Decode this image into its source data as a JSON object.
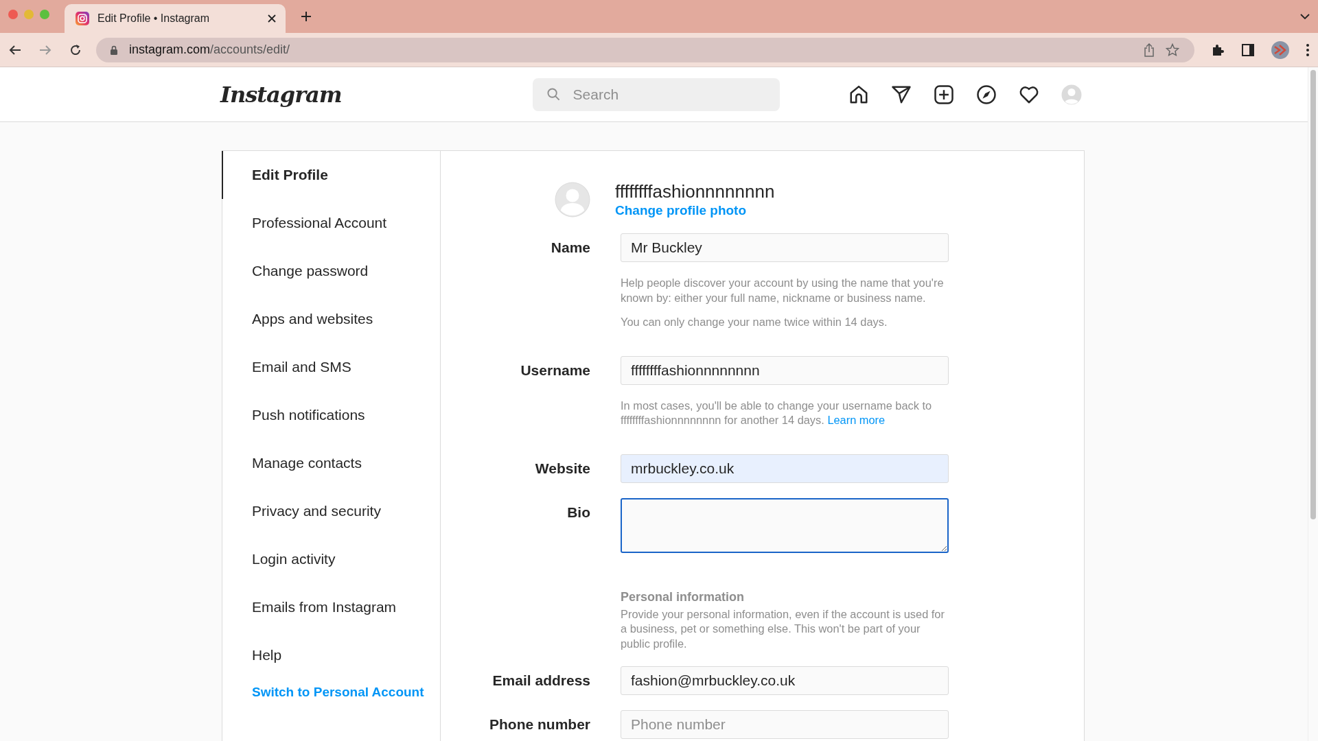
{
  "browser": {
    "tab": {
      "title": "Edit Profile • Instagram"
    },
    "url_host": "instagram.com",
    "url_path": "/accounts/edit/"
  },
  "header": {
    "logo": "Instagram",
    "search": {
      "placeholder": "Search"
    }
  },
  "sidebar": {
    "items": [
      {
        "label": "Edit Profile",
        "selected": true
      },
      {
        "label": "Professional Account",
        "selected": false
      },
      {
        "label": "Change password",
        "selected": false
      },
      {
        "label": "Apps and websites",
        "selected": false
      },
      {
        "label": "Email and SMS",
        "selected": false
      },
      {
        "label": "Push notifications",
        "selected": false
      },
      {
        "label": "Manage contacts",
        "selected": false
      },
      {
        "label": "Privacy and security",
        "selected": false
      },
      {
        "label": "Login activity",
        "selected": false
      },
      {
        "label": "Emails from Instagram",
        "selected": false
      },
      {
        "label": "Help",
        "selected": false
      }
    ],
    "switch_link": "Switch to Personal Account"
  },
  "profile": {
    "username": "ffffffffashionnnnnnnn",
    "change_photo": "Change profile photo"
  },
  "form": [
    {
      "kind": "input",
      "label": "Name",
      "value": "Mr Buckley",
      "autofilled": false,
      "focused": false,
      "help": [
        {
          "text": "Help people discover your account by using the name that you're known by: either your full name, nickname or business name."
        },
        {
          "text": "You can only change your name twice within 14 days."
        }
      ]
    },
    {
      "kind": "input",
      "label": "Username",
      "value": "ffffffffashionnnnnnnn",
      "autofilled": false,
      "focused": false,
      "help": [
        {
          "text": "In most cases, you'll be able to change your username back to ffffffffashionnnnnnnn for another 14 days.",
          "link": "Learn more"
        }
      ]
    },
    {
      "kind": "input",
      "label": "Website",
      "value": "mrbuckley.co.uk",
      "autofilled": true,
      "focused": false
    },
    {
      "kind": "textarea",
      "label": "Bio",
      "autofilled": false,
      "focused": true
    },
    {
      "kind": "section",
      "title": "Personal information",
      "text": "Provide your personal information, even if the account is used for a business, pet or something else. This won't be part of your public profile."
    },
    {
      "kind": "input",
      "label": "Email address",
      "value": "fashion@mrbuckley.co.uk",
      "autofilled": false,
      "focused": false
    },
    {
      "kind": "input",
      "label": "Phone number",
      "placeholder": "Phone number",
      "autofilled": false,
      "focused": false
    }
  ]
}
